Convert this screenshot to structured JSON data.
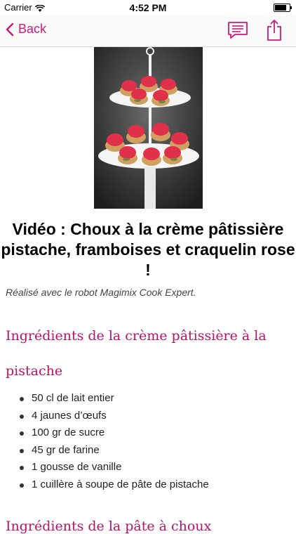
{
  "status_bar": {
    "carrier": "Carrier",
    "time": "4:52 PM",
    "battery_level": 0.9
  },
  "nav": {
    "back_label": "Back",
    "accent_color": "#cc1a7a"
  },
  "article": {
    "title": "Vidéo : Choux à la crème pâtissière pistache, framboises et craquelin rose !",
    "caption": "Réalisé avec le robot Magimix Cook Expert.",
    "section_1_heading_line1": "Ingrédients de la crème pâtissière à la",
    "section_1_heading_line2": "pistache",
    "ingredients": [
      "50 cl de lait entier",
      "4 jaunes d’œufs",
      "100 gr de sucre",
      "45 gr de farine",
      "1 gousse de vanille",
      "1 cuillère à soupe de pâte de pistache"
    ],
    "section_2_heading": "Ingrédients de la pâte à choux"
  }
}
